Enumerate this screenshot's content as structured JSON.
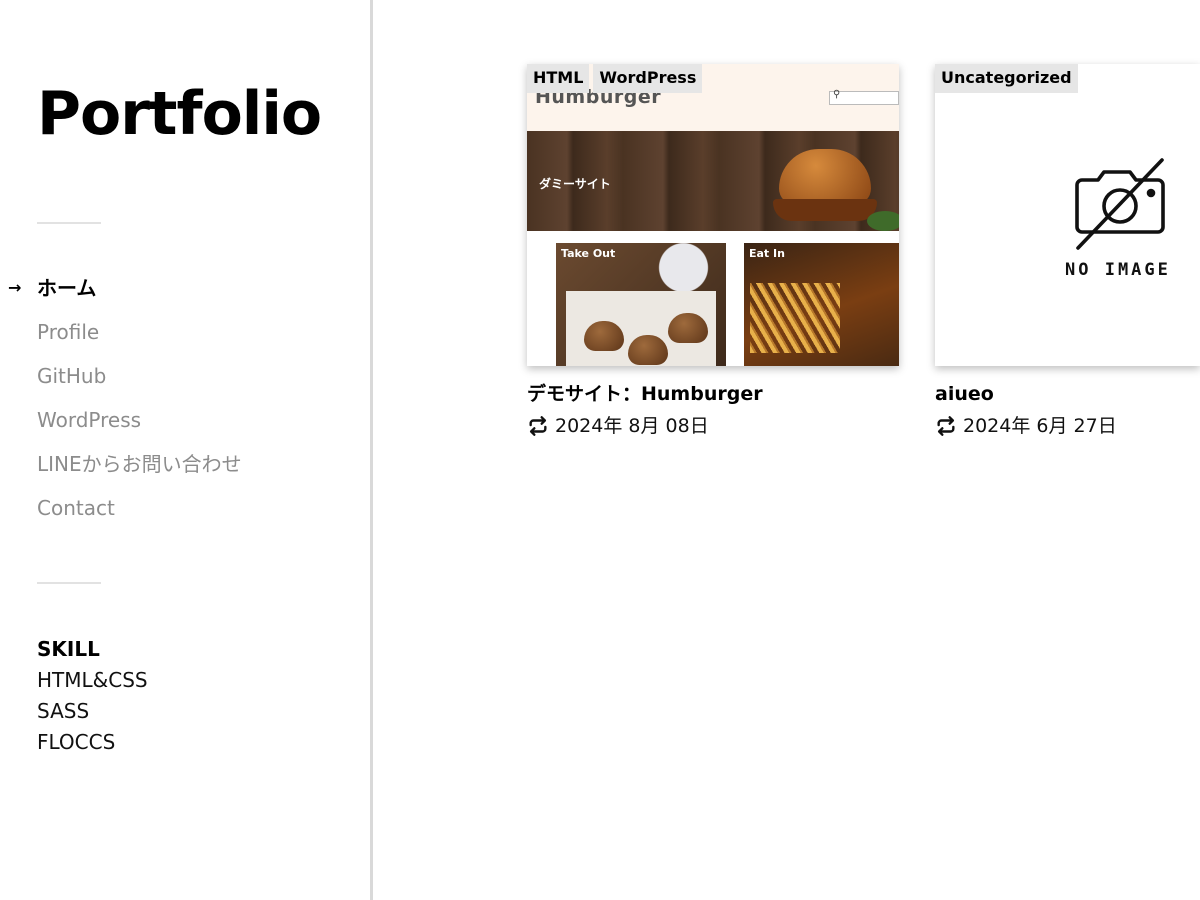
{
  "sidebar": {
    "site_title": "Portfolio",
    "active_marker": "→",
    "nav": [
      {
        "label": "ホーム",
        "active": true
      },
      {
        "label": "Profile",
        "active": false
      },
      {
        "label": "GitHub",
        "active": false
      },
      {
        "label": "WordPress",
        "active": false
      },
      {
        "label": "LINEからお問い合わせ",
        "active": false
      },
      {
        "label": "Contact",
        "active": false
      }
    ],
    "skill": {
      "title": "SKILL",
      "items": [
        "HTML&CSS",
        "SASS",
        "FLOCCS"
      ]
    }
  },
  "posts": [
    {
      "tags": [
        "HTML",
        "WordPress"
      ],
      "thumbnail": {
        "logo": "Humburger",
        "hero_text": "ダミーサイト",
        "panel_1": "Take Out",
        "panel_2": "Eat In"
      },
      "title": "デモサイト：Humburger",
      "date": "2024年 8月 08日",
      "date_icon": "repeat-icon"
    },
    {
      "tags": [
        "Uncategorized"
      ],
      "thumbnail": {
        "placeholder_text": "NO IMAGE",
        "placeholder_icon": "camera-off-icon"
      },
      "title": "aiueo",
      "date": "2024年 6月 27日",
      "date_icon": "repeat-icon"
    }
  ],
  "colors": {
    "active_text": "#000000",
    "inactive_text": "#8c8c8c",
    "divider": "#d9d9d9",
    "tag_bg": "#e6e6e6"
  }
}
